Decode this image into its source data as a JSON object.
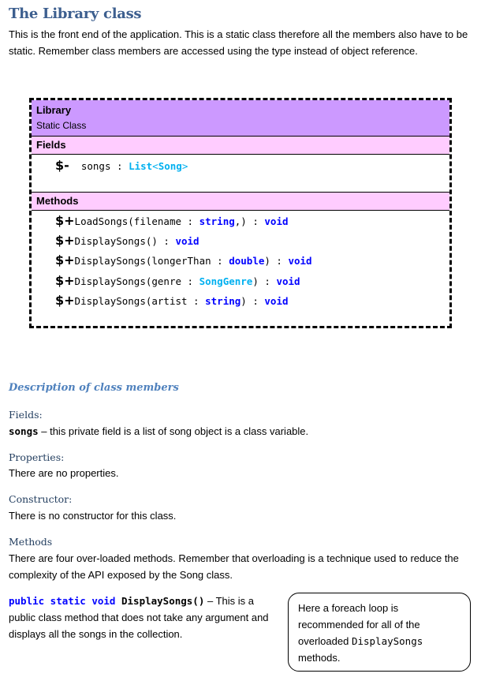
{
  "heading": "The Library class",
  "intro": "This is the front end of the application. This is a static class therefore all the members also have to be static. Remember class members are accessed using the type instead of object reference.",
  "uml": {
    "class_name": "Library",
    "stereotype": "Static Class",
    "fields_label": "Fields",
    "fields": [
      {
        "symbol": "$-",
        "name": "songs",
        "sep": " : ",
        "type_a": "List",
        "lt": "<",
        "type_b": "Song",
        "gt": ">"
      }
    ],
    "methods_label": "Methods",
    "methods": [
      {
        "symbol": "$+",
        "sig": "LoadSongs(filename : ",
        "param_type": "string",
        "tail": ",) : ",
        "ret": "void",
        "param_kind": "kw"
      },
      {
        "symbol": "$+",
        "sig": "DisplaySongs() : ",
        "param_type": "",
        "tail": "",
        "ret": "void",
        "param_kind": "kw"
      },
      {
        "symbol": "$+",
        "sig": "DisplaySongs(longerThan : ",
        "param_type": "double",
        "tail": ") : ",
        "ret": "void",
        "param_kind": "kw"
      },
      {
        "symbol": "$+",
        "sig": "DisplaySongs(genre : ",
        "param_type": "SongGenre",
        "tail": ") : ",
        "ret": "void",
        "param_kind": "typ"
      },
      {
        "symbol": "$+",
        "sig": "DisplaySongs(artist : ",
        "param_type": "string",
        "tail": ") : ",
        "ret": "void",
        "param_kind": "kw"
      }
    ]
  },
  "description": {
    "heading": "Description of class members",
    "fields_label": "Fields:",
    "fields_term": "songs",
    "fields_text": " – this private field is a list of song object is a class variable.",
    "properties_label": "Properties:",
    "properties_text": "There are no properties.",
    "constructor_label": "Constructor:",
    "constructor_text": "There is no constructor for this class.",
    "methods_label": "Methods",
    "methods_text": "There are four over-loaded methods. Remember that overloading is a technique used to reduce the complexity of the API exposed by the Song class.",
    "method1_kw": "public static void",
    "method1_name": " DisplaySongs()",
    "method1_text": " – This is a public class method that does not take any argument and displays all the songs in the collection."
  },
  "note": {
    "text_a": "Here a foreach loop is recommended for all of the overloaded ",
    "code": "DisplaySongs",
    "text_b": " methods."
  }
}
